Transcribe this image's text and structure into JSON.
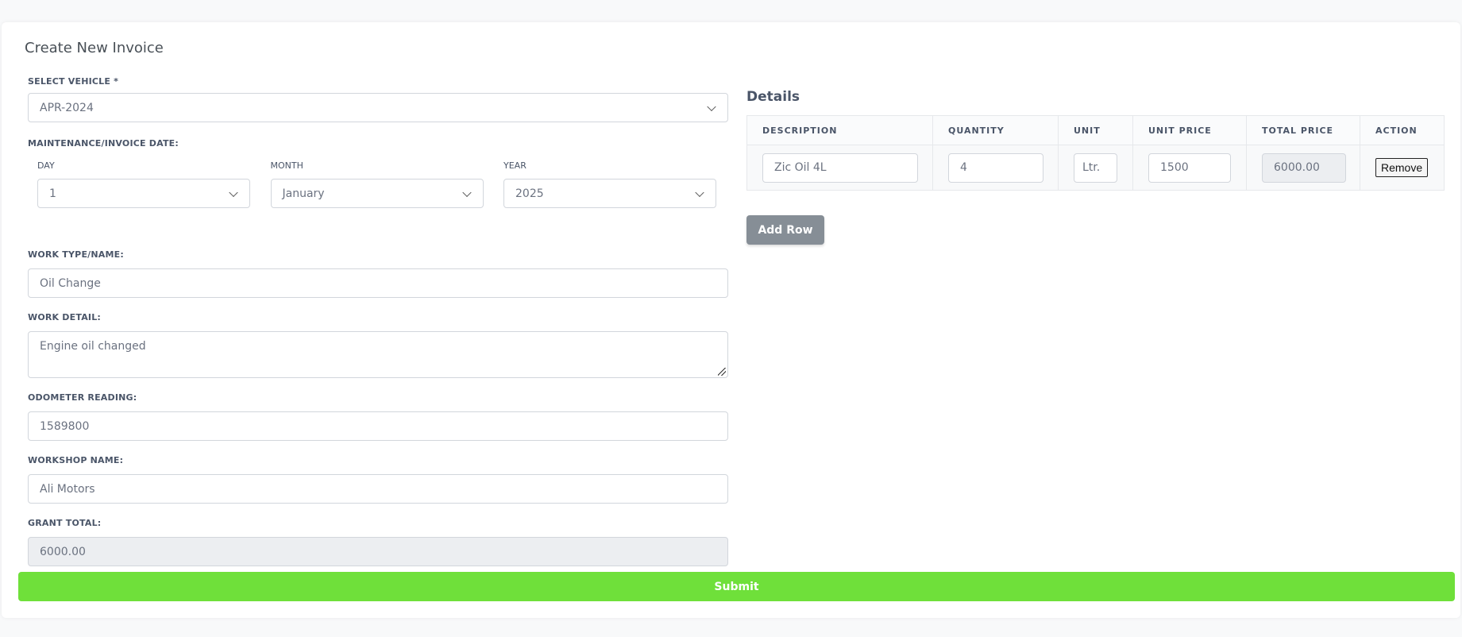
{
  "form": {
    "title": "Create New Invoice",
    "vehicle": {
      "label": "SELECT VEHICLE *",
      "value": "APR-2024"
    },
    "date": {
      "label": "MAINTENANCE/INVOICE DATE:",
      "day": {
        "label": "DAY",
        "value": "1"
      },
      "month": {
        "label": "MONTH",
        "value": "January"
      },
      "year": {
        "label": "YEAR",
        "value": "2025"
      }
    },
    "work_type": {
      "label": "WORK TYPE/NAME:",
      "value": "Oil Change"
    },
    "work_detail": {
      "label": "WORK DETAIL:",
      "value": "Engine oil changed"
    },
    "odometer": {
      "label": "ODOMETER READING:",
      "value": "1589800"
    },
    "workshop": {
      "label": "WORKSHOP NAME:",
      "value": "Ali Motors"
    },
    "grand_total": {
      "label": "GRANT TOTAL:",
      "value": "6000.00"
    },
    "submit_label": "Submit"
  },
  "details": {
    "title": "Details",
    "columns": [
      "DESCRIPTION",
      "QUANTITY",
      "UNIT",
      "UNIT PRICE",
      "TOTAL PRICE",
      "ACTION"
    ],
    "rows": [
      {
        "description": "Zic Oil 4L",
        "quantity": "4",
        "unit": "Ltr.",
        "unit_price": "1500",
        "total_price": "6000.00",
        "action": "Remove"
      }
    ],
    "add_row_label": "Add Row"
  },
  "colors": {
    "submit": "#6fe03a",
    "add_row": "#868e96",
    "readonly_bg": "#eceef1"
  },
  "icons": {
    "select_arrow": "chevron-down-icon",
    "textarea_resize": "resize-handle-icon"
  }
}
